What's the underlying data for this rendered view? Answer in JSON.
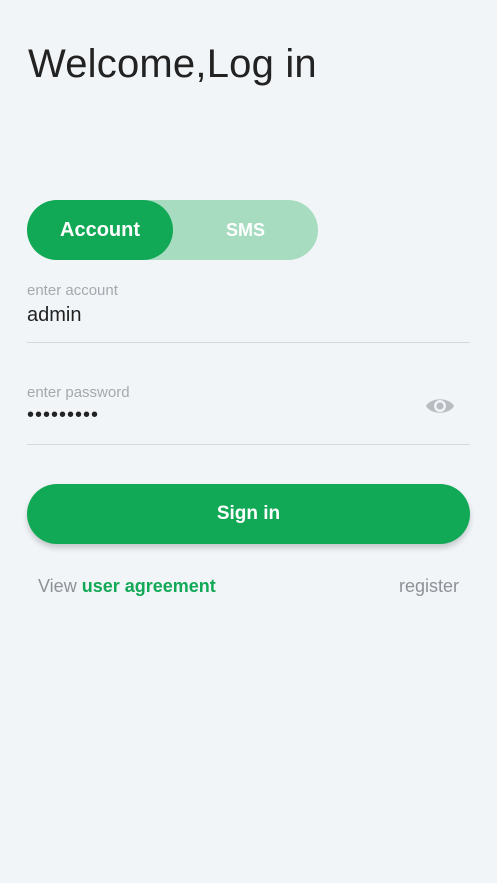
{
  "header": {
    "title": "Welcome,Log in"
  },
  "login_mode": {
    "options": [
      {
        "label": "Account",
        "active": true
      },
      {
        "label": "SMS",
        "active": false
      }
    ]
  },
  "account_field": {
    "label": "enter account",
    "value": "admin"
  },
  "password_field": {
    "label": "enter password",
    "value": "•••••••••",
    "toggle_icon": "eye-icon"
  },
  "actions": {
    "sign_in_label": "Sign in",
    "agreement_prefix": "View",
    "agreement_link": "user agreement",
    "register_label": "register"
  },
  "colors": {
    "accent": "#12a956",
    "accent_light": "#a7dcc1",
    "background": "#f1f5f8",
    "muted_text": "#8d9297"
  }
}
